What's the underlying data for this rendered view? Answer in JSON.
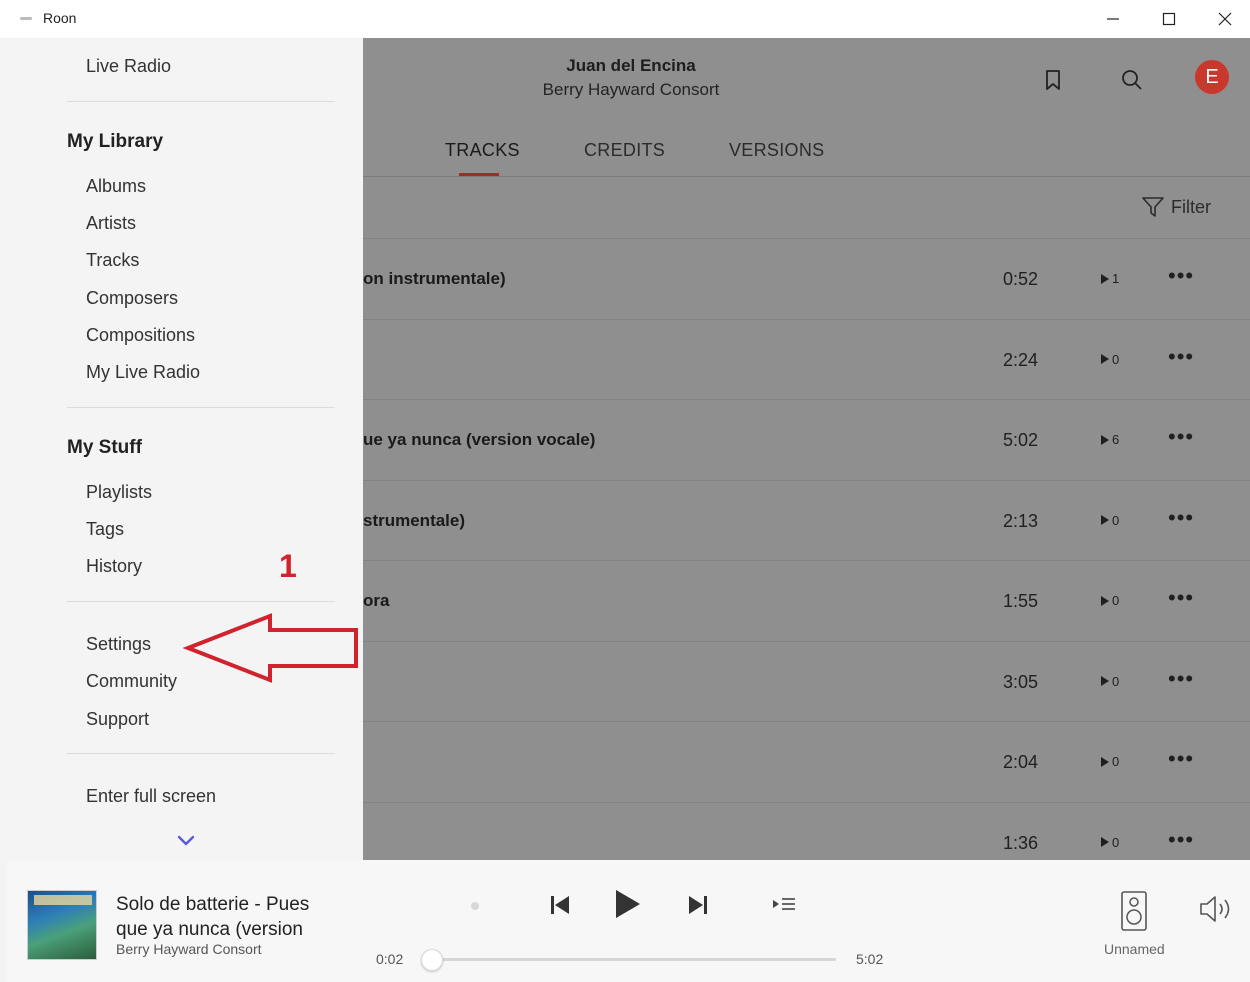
{
  "window": {
    "title": "Roon",
    "minimize_icon": "minimize-icon",
    "maximize_icon": "maximize-icon",
    "close_icon": "close-icon"
  },
  "header": {
    "artist": "Juan del Encina",
    "subtitle": "Berry Hayward Consort",
    "avatar_letter": "E",
    "avatar_color": "#c8382c"
  },
  "tabs": [
    {
      "label": "TRACKS",
      "active": true
    },
    {
      "label": "CREDITS",
      "active": false
    },
    {
      "label": "VERSIONS",
      "active": false
    }
  ],
  "filter_label": "Filter",
  "tracks": [
    {
      "title": "on instrumentale)",
      "time": "0:52",
      "plays": "1"
    },
    {
      "title": "",
      "time": "2:24",
      "plays": "0"
    },
    {
      "title": "ue ya nunca (version vocale)",
      "time": "5:02",
      "plays": "6"
    },
    {
      "title": "strumentale)",
      "time": "2:13",
      "plays": "0"
    },
    {
      "title": "ora",
      "time": "1:55",
      "plays": "0"
    },
    {
      "title": "",
      "time": "3:05",
      "plays": "0"
    },
    {
      "title": "",
      "time": "2:04",
      "plays": "0"
    },
    {
      "title": "",
      "time": "1:36",
      "plays": "0"
    }
  ],
  "nav": {
    "live_radio": "Live Radio",
    "my_library": {
      "title": "My Library",
      "items": [
        "Albums",
        "Artists",
        "Tracks",
        "Composers",
        "Compositions",
        "My Live Radio"
      ]
    },
    "my_stuff": {
      "title": "My Stuff",
      "items": [
        "Playlists",
        "Tags",
        "History"
      ]
    },
    "system_items": [
      "Settings",
      "Community",
      "Support"
    ],
    "full_screen": "Enter full screen"
  },
  "annotation": {
    "number": "1",
    "color": "#d0232d"
  },
  "player": {
    "now_playing_title": "Solo de batterie - Pues que ya nunca (version",
    "now_playing_artist": "Berry Hayward Consort",
    "time_current": "0:02",
    "time_total": "5:02",
    "progress": 0.007,
    "zone_name": "Unnamed"
  }
}
